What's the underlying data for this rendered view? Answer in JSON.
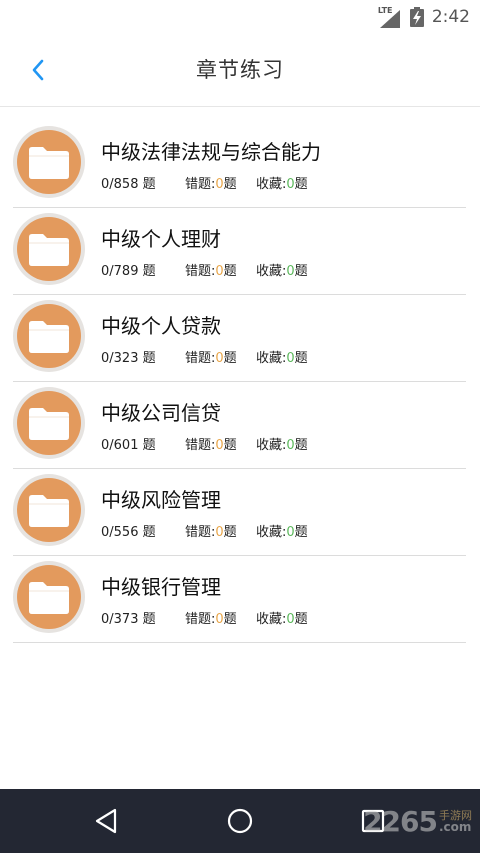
{
  "status_bar": {
    "network": "LTE",
    "time": "2:42"
  },
  "header": {
    "title": "章节练习",
    "back_icon": "chevron-left-icon",
    "accent_color": "#2196f3"
  },
  "chapters": [
    {
      "title": "中级法律法规与综合能力",
      "progress": "0/858 题",
      "wrong_label": "错题:",
      "wrong_count": "0",
      "wrong_unit": "题",
      "fav_label": "收藏:",
      "fav_count": "0",
      "fav_unit": "题"
    },
    {
      "title": "中级个人理财",
      "progress": "0/789 题",
      "wrong_label": "错题:",
      "wrong_count": "0",
      "wrong_unit": "题",
      "fav_label": "收藏:",
      "fav_count": "0",
      "fav_unit": "题"
    },
    {
      "title": "中级个人贷款",
      "progress": "0/323 题",
      "wrong_label": "错题:",
      "wrong_count": "0",
      "wrong_unit": "题",
      "fav_label": "收藏:",
      "fav_count": "0",
      "fav_unit": "题"
    },
    {
      "title": "中级公司信贷",
      "progress": "0/601 题",
      "wrong_label": "错题:",
      "wrong_count": "0",
      "wrong_unit": "题",
      "fav_label": "收藏:",
      "fav_count": "0",
      "fav_unit": "题"
    },
    {
      "title": "中级风险管理",
      "progress": "0/556 题",
      "wrong_label": "错题:",
      "wrong_count": "0",
      "wrong_unit": "题",
      "fav_label": "收藏:",
      "fav_count": "0",
      "fav_unit": "题"
    },
    {
      "title": "中级银行管理",
      "progress": "0/373 题",
      "wrong_label": "错题:",
      "wrong_count": "0",
      "wrong_unit": "题",
      "fav_label": "收藏:",
      "fav_count": "0",
      "fav_unit": "题"
    }
  ],
  "colors": {
    "folder_circle": "#e39a5d",
    "wrong_count": "#e8a64a",
    "fav_count": "#5cb85c",
    "nav_bar": "#232733"
  },
  "nav_bar": {
    "back_icon": "triangle-back-icon",
    "home_icon": "circle-home-icon",
    "recents_icon": "square-recents-icon"
  },
  "watermark": {
    "number": "2265",
    "cn": "手游网",
    "com": ".com"
  }
}
